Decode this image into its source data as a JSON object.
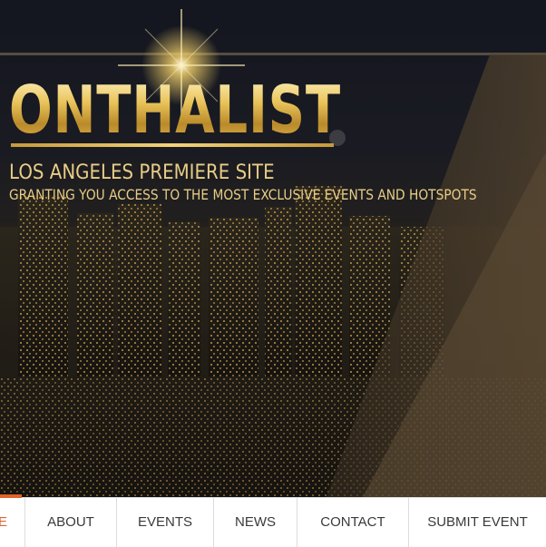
{
  "logo": {
    "name": "ONTHALIST",
    "subtitle": "LOS ANGELES PREMIERE SITE",
    "tagline": "GRANTING YOU ACCESS TO THE MOST EXCLUSIVE EVENTS AND HOTSPOTS"
  },
  "nav": {
    "items": [
      {
        "label": "HOME",
        "visible_label": "E"
      },
      {
        "label": "ABOUT"
      },
      {
        "label": "EVENTS"
      },
      {
        "label": "NEWS"
      },
      {
        "label": "CONTACT"
      },
      {
        "label": "SUBMIT EVENT"
      }
    ]
  },
  "colors": {
    "accent": "#e0632a",
    "gold": "#e8cd86",
    "nav_text": "#3a3a3a"
  }
}
